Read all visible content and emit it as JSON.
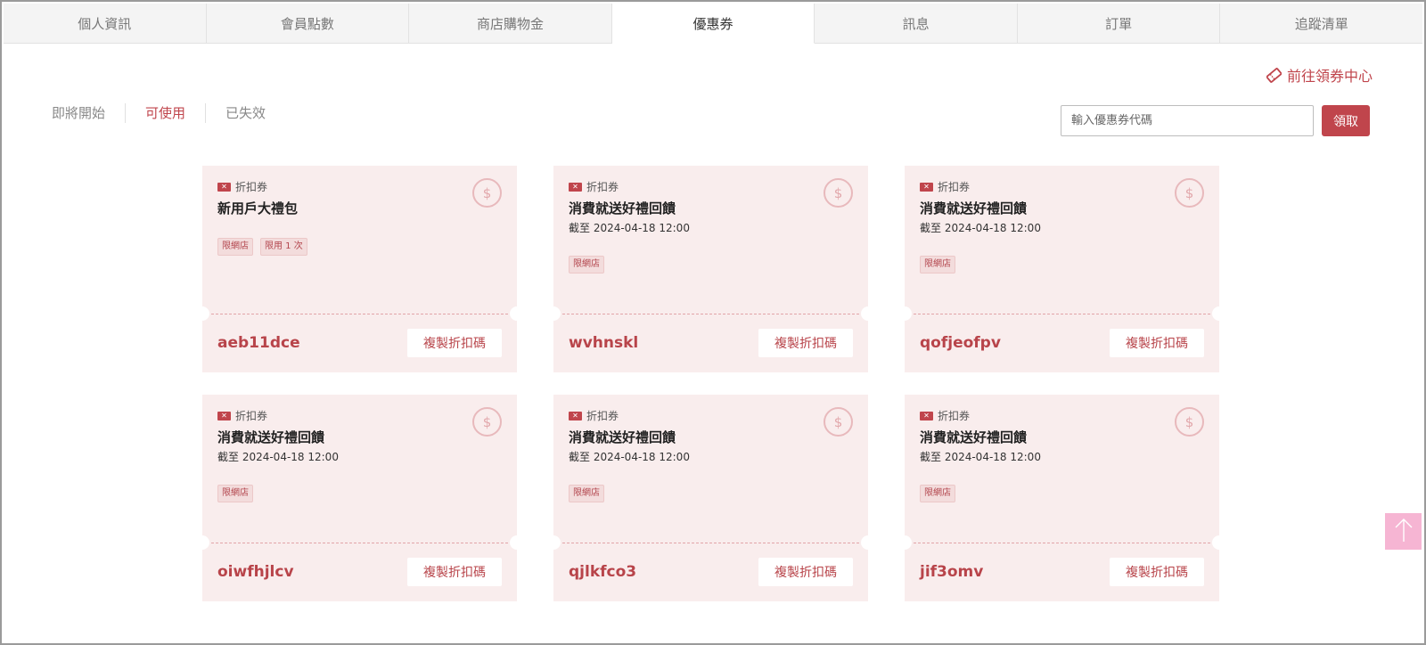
{
  "tabs": [
    {
      "label": "個人資訊"
    },
    {
      "label": "會員點數"
    },
    {
      "label": "商店購物金"
    },
    {
      "label": "優惠券",
      "active": true
    },
    {
      "label": "訊息"
    },
    {
      "label": "訂單"
    },
    {
      "label": "追蹤清單"
    }
  ],
  "center_link": {
    "label": "前往領券中心",
    "icon": "ticket-icon"
  },
  "filters": [
    {
      "label": "即將開始"
    },
    {
      "label": "可使用",
      "active": true
    },
    {
      "label": "已失效"
    }
  ],
  "redeem": {
    "placeholder": "輸入優惠券代碼",
    "value": "",
    "button_label": "領取"
  },
  "coupons": [
    {
      "type": "折扣券",
      "title": "新用戶大禮包",
      "expiry": "",
      "tags": [
        "限網店",
        "限用 1 次"
      ],
      "code": "aeb11dce",
      "copy_label": "複製折扣碼"
    },
    {
      "type": "折扣券",
      "title": "消費就送好禮回饋",
      "expiry": "截至 2024-04-18 12:00",
      "tags": [
        "限網店"
      ],
      "code": "wvhnskl",
      "copy_label": "複製折扣碼"
    },
    {
      "type": "折扣券",
      "title": "消費就送好禮回饋",
      "expiry": "截至 2024-04-18 12:00",
      "tags": [
        "限網店"
      ],
      "code": "qofjeofpv",
      "copy_label": "複製折扣碼"
    },
    {
      "type": "折扣券",
      "title": "消費就送好禮回饋",
      "expiry": "截至 2024-04-18 12:00",
      "tags": [
        "限網店"
      ],
      "code": "oiwfhjlcv",
      "copy_label": "複製折扣碼"
    },
    {
      "type": "折扣券",
      "title": "消費就送好禮回饋",
      "expiry": "截至 2024-04-18 12:00",
      "tags": [
        "限網店"
      ],
      "code": "qjlkfco3",
      "copy_label": "複製折扣碼"
    },
    {
      "type": "折扣券",
      "title": "消費就送好禮回饋",
      "expiry": "截至 2024-04-18 12:00",
      "tags": [
        "限網店"
      ],
      "code": "jif3omv",
      "copy_label": "複製折扣碼"
    }
  ],
  "colors": {
    "accent": "#c0454c",
    "coupon_bg": "#f9eded",
    "back_to_top": "#f6b5d3"
  },
  "icons": {
    "coupon_type": "ticket-icon",
    "coupon_badge": "dollar-circle-icon",
    "back_to_top": "arrow-up-icon"
  }
}
